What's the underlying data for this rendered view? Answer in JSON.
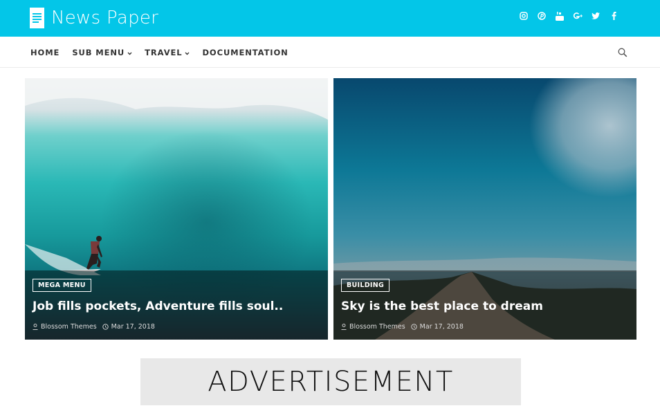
{
  "header": {
    "site_title": "News Paper",
    "logo_icon": "document-icon",
    "background_color": "#03c6e8",
    "social_icons": [
      {
        "name": "instagram-icon"
      },
      {
        "name": "pinterest-icon"
      },
      {
        "name": "youtube-icon"
      },
      {
        "name": "google-plus-icon"
      },
      {
        "name": "twitter-icon"
      },
      {
        "name": "facebook-icon"
      }
    ]
  },
  "nav": {
    "items": [
      {
        "label": "HOME",
        "has_dropdown": false
      },
      {
        "label": "SUB MENU",
        "has_dropdown": true
      },
      {
        "label": "TRAVEL",
        "has_dropdown": true
      },
      {
        "label": "DOCUMENTATION",
        "has_dropdown": false
      }
    ],
    "search_icon": "search-icon"
  },
  "posts": [
    {
      "category": "MEGA MENU",
      "title": "Job fills pockets, Adventure fills soul..",
      "author": "Blossom Themes",
      "date": "Mar 17, 2018",
      "image_description": "Surfer riding a large turquoise wave"
    },
    {
      "category": "BUILDING",
      "title": "Sky is the best place to dream",
      "author": "Blossom Themes",
      "date": "Mar 17, 2018",
      "image_description": "Hiker on a mountain ridge under a blue sky with clouds"
    }
  ],
  "advertisement": {
    "label": "ADVERTISEMENT"
  }
}
